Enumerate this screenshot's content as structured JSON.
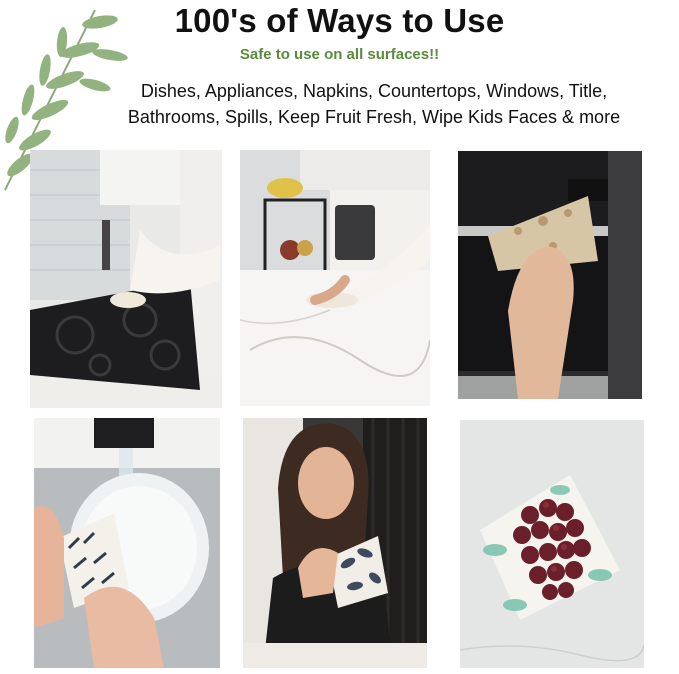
{
  "header": {
    "title": "100's of Ways to Use",
    "subtitle": "Safe to use on all surfaces!!",
    "uses_line1": "Dishes, Appliances, Napkins, Countertops, Windows, Title,",
    "uses_line2": "Bathrooms, Spills, Keep Fruit Fresh, Wipe Kids Faces & more"
  },
  "colors": {
    "subtitle": "#5b8a3c",
    "leaf": "#7fa66a",
    "title": "#111111"
  },
  "photos": [
    {
      "name": "stovetop-wiping-photo"
    },
    {
      "name": "countertop-wiping-photo"
    },
    {
      "name": "oven-door-wiping-photo"
    },
    {
      "name": "dish-washing-photo"
    },
    {
      "name": "woman-with-cloth-photo"
    },
    {
      "name": "grapes-on-cloth-photo"
    }
  ]
}
